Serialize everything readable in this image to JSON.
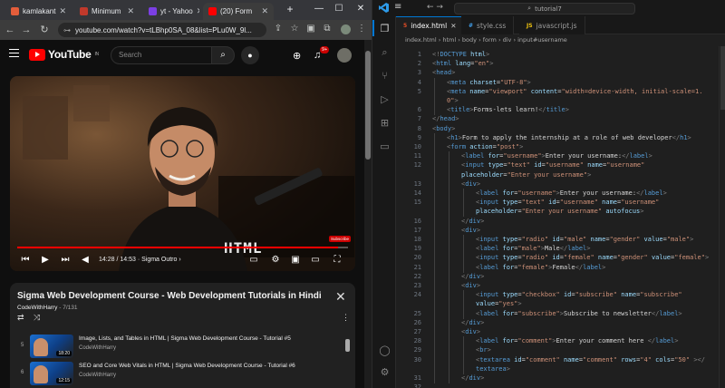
{
  "browser": {
    "tabs": [
      {
        "label": "kamlakant",
        "color": "#e35d3b"
      },
      {
        "label": "Minimum",
        "color": "#c0392b"
      },
      {
        "label": "yt - Yahoo",
        "color": "#7b3fe4"
      },
      {
        "label": "(20) Form",
        "color": "#ff0000"
      }
    ],
    "new_tab": "+",
    "window_minimize": "—",
    "window_maximize": "☐",
    "window_close": "✕",
    "url": "youtube.com/watch?v=tLBhp0SA_08&list=PLu0W_9l..."
  },
  "youtube": {
    "logo_text": "YouTube",
    "region": "IN",
    "search_placeholder": "Search",
    "notification_count": "9+",
    "player": {
      "overlay_text": "HTML",
      "timecode": "14:28 / 14:53 · Sigma Outro ›",
      "progress": 0.97,
      "subs_chip": "Subscribe"
    },
    "playlist": {
      "title": "Sigma Web Development Course - Web Development Tutorials in Hindi 🗿",
      "channel": "CodeWithHarry",
      "count": " - 7/131",
      "items": [
        {
          "index": "5",
          "title": "Image, Lists, and Tables in HTML | Sigma Web Development Course - Tutorial #5",
          "channel": "CodeWithHarry",
          "duration": "18:20"
        },
        {
          "index": "6",
          "title": "SEO and Core Web Vitals in HTML | Sigma Web Development Course - Tutorial #6",
          "channel": "CodeWithHarry",
          "duration": "12:15"
        }
      ]
    }
  },
  "vscode": {
    "command_center": "tutorial7",
    "tabs": [
      {
        "label": "index.html",
        "icon": "5",
        "icon_color": "#e44d26"
      },
      {
        "label": "style.css",
        "icon": "#",
        "icon_color": "#42a5f5"
      },
      {
        "label": "javascript.js",
        "icon": "JS",
        "icon_color": "#f1c40f"
      }
    ],
    "breadcrumb": "index.html › html › body › form › div › input#username",
    "lines": [
      {
        "n": "1",
        "indent": 0,
        "html": "<span class='pu'>&lt;!</span><span class='tg'>DOCTYPE</span> <span class='at'>html</span><span class='pu'>&gt;</span>"
      },
      {
        "n": "2",
        "indent": 0,
        "html": "<span class='pu'>&lt;</span><span class='tg'>html</span> <span class='at'>lang</span>=<span class='st'>\"en\"</span><span class='pu'>&gt;</span>"
      },
      {
        "n": "3",
        "indent": 0,
        "html": "<span class='pu'>&lt;</span><span class='tg'>head</span><span class='pu'>&gt;</span>"
      },
      {
        "n": "4",
        "indent": 1,
        "html": "<span class='pu'>&lt;</span><span class='tg'>meta</span> <span class='at'>charset</span>=<span class='st'>\"UTF-8\"</span><span class='pu'>&gt;</span>"
      },
      {
        "n": "5",
        "indent": 1,
        "html": "<span class='pu'>&lt;</span><span class='tg'>meta</span> <span class='at'>name</span>=<span class='st'>\"viewport\"</span> <span class='at'>content</span>=<span class='st'>\"width=device-width, initial-scale=1.</span>"
      },
      {
        "n": "",
        "indent": 1,
        "html": "<span class='st'>0\"</span><span class='pu'>&gt;</span>"
      },
      {
        "n": "6",
        "indent": 1,
        "html": "<span class='pu'>&lt;</span><span class='tg'>title</span><span class='pu'>&gt;</span><span class='tx'>Forms-lets learn!</span><span class='pu'>&lt;/</span><span class='tg'>title</span><span class='pu'>&gt;</span>"
      },
      {
        "n": "7",
        "indent": 0,
        "html": "<span class='pu'>&lt;/</span><span class='tg'>head</span><span class='pu'>&gt;</span>"
      },
      {
        "n": "8",
        "indent": 0,
        "html": "<span class='pu'>&lt;</span><span class='tg'>body</span><span class='pu'>&gt;</span>"
      },
      {
        "n": "9",
        "indent": 1,
        "html": "<span class='pu'>&lt;</span><span class='tg'>h1</span><span class='pu'>&gt;</span><span class='tx'>Form to apply the internship at a role of web developer</span><span class='pu'>&lt;/</span><span class='tg'>h1</span><span class='pu'>&gt;</span>"
      },
      {
        "n": "10",
        "indent": 1,
        "html": "<span class='pu'>&lt;</span><span class='tg'>form</span> <span class='at'>action</span>=<span class='st'>\"post\"</span><span class='pu'>&gt;</span>"
      },
      {
        "n": "11",
        "indent": 2,
        "html": "<span class='pu'>&lt;</span><span class='tg'>label</span> <span class='at'>for</span>=<span class='st'>\"username\"</span><span class='pu'>&gt;</span><span class='tx'>Enter your username:</span><span class='pu'>&lt;/</span><span class='tg'>label</span><span class='pu'>&gt;</span>"
      },
      {
        "n": "12",
        "indent": 2,
        "html": "<span class='pu'>&lt;</span><span class='tg'>input</span> <span class='at'>type</span>=<span class='st'>\"text\"</span> <span class='at'>id</span>=<span class='st'>\"username\"</span> <span class='at'>name</span>=<span class='st'>\"username\"</span>"
      },
      {
        "n": "",
        "indent": 2,
        "html": "<span class='at'>placeholder</span>=<span class='st'>\"Enter your username\"</span><span class='pu'>&gt;</span>"
      },
      {
        "n": "13",
        "indent": 2,
        "html": "<span class='pu'>&lt;</span><span class='tg'>div</span><span class='pu'>&gt;</span>"
      },
      {
        "n": "14",
        "indent": 3,
        "html": "<span class='pu'>&lt;</span><span class='tg'>label</span> <span class='at'>for</span>=<span class='st'>\"username\"</span><span class='pu'>&gt;</span><span class='tx'>Enter your username:</span><span class='pu'>&lt;/</span><span class='tg'>label</span><span class='pu'>&gt;</span>"
      },
      {
        "n": "15",
        "indent": 3,
        "html": "<span class='pu'>&lt;</span><span class='tg'>input</span> <span class='at'>type</span>=<span class='st'>\"text\"</span> <span class='at'>id</span>=<span class='st'>\"username\"</span> <span class='at'>name</span>=<span class='st'>\"username\"</span>"
      },
      {
        "n": "",
        "indent": 3,
        "html": "<span class='at'>placeholder</span>=<span class='st'>\"Enter your username\"</span> <span class='at'>autofocus</span><span class='pu'>&gt;</span>"
      },
      {
        "n": "16",
        "indent": 2,
        "html": "<span class='pu'>&lt;/</span><span class='tg'>div</span><span class='pu'>&gt;</span>"
      },
      {
        "n": "17",
        "indent": 2,
        "html": "<span class='pu'>&lt;</span><span class='tg'>div</span><span class='pu'>&gt;</span>"
      },
      {
        "n": "18",
        "indent": 3,
        "html": "<span class='pu'>&lt;</span><span class='tg'>input</span> <span class='at'>type</span>=<span class='st'>\"radio\"</span> <span class='at'>id</span>=<span class='st'>\"male\"</span> <span class='at'>name</span>=<span class='st'>\"gender\"</span> <span class='at'>value</span>=<span class='st'>\"male\"</span><span class='pu'>&gt;</span>"
      },
      {
        "n": "19",
        "indent": 3,
        "html": "<span class='pu'>&lt;</span><span class='tg'>label</span> <span class='at'>for</span>=<span class='st'>\"male\"</span><span class='pu'>&gt;</span><span class='tx'>Male</span><span class='pu'>&lt;/</span><span class='tg'>label</span><span class='pu'>&gt;</span>"
      },
      {
        "n": "20",
        "indent": 3,
        "html": "<span class='pu'>&lt;</span><span class='tg'>input</span> <span class='at'>type</span>=<span class='st'>\"radio\"</span> <span class='at'>id</span>=<span class='st'>\"female\"</span> <span class='at'>name</span>=<span class='st'>\"gender\"</span> <span class='at'>value</span>=<span class='st'>\"female\"</span><span class='pu'>&gt;</span>"
      },
      {
        "n": "21",
        "indent": 3,
        "html": "<span class='pu'>&lt;</span><span class='tg'>label</span> <span class='at'>for</span>=<span class='st'>\"female\"</span><span class='pu'>&gt;</span><span class='tx'>Female</span><span class='pu'>&lt;/</span><span class='tg'>label</span><span class='pu'>&gt;</span>"
      },
      {
        "n": "22",
        "indent": 2,
        "html": "<span class='pu'>&lt;/</span><span class='tg'>div</span><span class='pu'>&gt;</span>"
      },
      {
        "n": "23",
        "indent": 2,
        "html": "<span class='pu'>&lt;</span><span class='tg'>div</span><span class='pu'>&gt;</span>"
      },
      {
        "n": "24",
        "indent": 3,
        "html": "<span class='pu'>&lt;</span><span class='tg'>input</span> <span class='at'>type</span>=<span class='st'>\"checkbox\"</span> <span class='at'>id</span>=<span class='st'>\"subscribe\"</span> <span class='at'>name</span>=<span class='st'>\"subscribe\"</span>"
      },
      {
        "n": "",
        "indent": 3,
        "html": "<span class='at'>value</span>=<span class='st'>\"yes\"</span><span class='pu'>&gt;</span>"
      },
      {
        "n": "25",
        "indent": 3,
        "html": "<span class='pu'>&lt;</span><span class='tg'>label</span> <span class='at'>for</span>=<span class='st'>\"subscribe\"</span><span class='pu'>&gt;</span><span class='tx'>Subscribe to newsletter</span><span class='pu'>&lt;/</span><span class='tg'>label</span><span class='pu'>&gt;</span>"
      },
      {
        "n": "26",
        "indent": 2,
        "html": "<span class='pu'>&lt;/</span><span class='tg'>div</span><span class='pu'>&gt;</span>"
      },
      {
        "n": "27",
        "indent": 2,
        "html": "<span class='pu'>&lt;</span><span class='tg'>div</span><span class='pu'>&gt;</span>"
      },
      {
        "n": "28",
        "indent": 3,
        "html": "<span class='pu'>&lt;</span><span class='tg'>label</span> <span class='at'>for</span>=<span class='st'>\"comment\"</span><span class='pu'>&gt;</span><span class='tx'>Enter your comment here </span><span class='pu'>&lt;/</span><span class='tg'>label</span><span class='pu'>&gt;</span>"
      },
      {
        "n": "29",
        "indent": 3,
        "html": "<span class='pu'>&lt;</span><span class='tg'>br</span><span class='pu'>&gt;</span>"
      },
      {
        "n": "30",
        "indent": 3,
        "html": "<span class='pu'>&lt;</span><span class='tg'>textarea</span> <span class='at'>id</span>=<span class='st'>\"comment\"</span> <span class='at'>name</span>=<span class='st'>\"comment\"</span> <span class='at'>rows</span>=<span class='st'>\"4\"</span> <span class='at'>cols</span>=<span class='st'>\"50\"</span> <span class='pu'>&gt;&lt;/</span>"
      },
      {
        "n": "",
        "indent": 3,
        "html": "<span class='tg'>textarea</span><span class='pu'>&gt;</span>"
      },
      {
        "n": "31",
        "indent": 2,
        "html": "<span class='pu'>&lt;/</span><span class='tg'>div</span><span class='pu'>&gt;</span>"
      },
      {
        "n": "32",
        "indent": 0,
        "html": ""
      }
    ]
  }
}
